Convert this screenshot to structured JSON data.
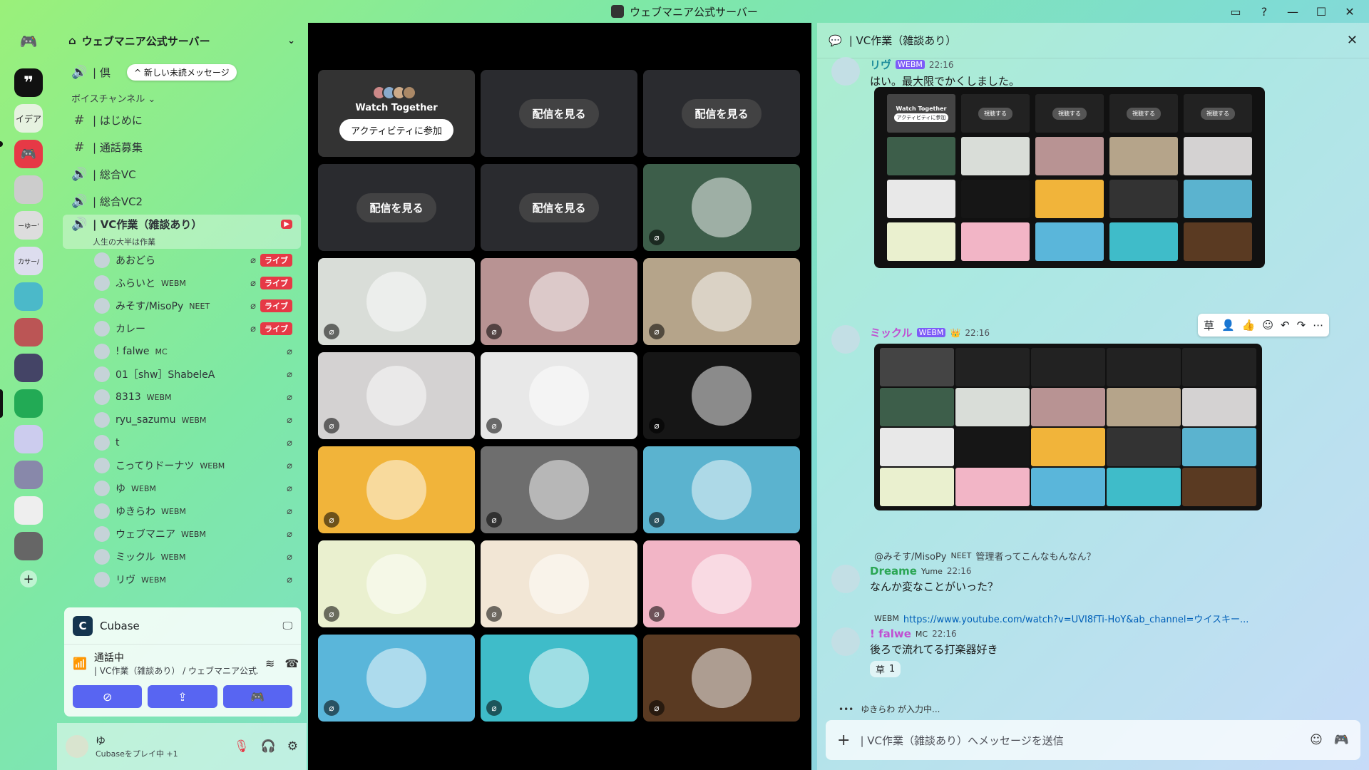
{
  "window": {
    "title": "ウェブマニア公式サーバー"
  },
  "rail": {
    "labels": [
      "イデア",
      "ーゆー'",
      "カサー/"
    ]
  },
  "server": {
    "name": "ウェブマニア公式サーバー",
    "new_messages_badge": "新しい未読メッセージ"
  },
  "channels": {
    "category": "ボイスチャンネル",
    "items": [
      {
        "name": "| はじめに",
        "type": "text"
      },
      {
        "name": "| 通話募集",
        "type": "text"
      },
      {
        "name": "| 総合VC",
        "type": "voice"
      },
      {
        "name": "| 総合VC2",
        "type": "voice"
      },
      {
        "name": "| VC作業（雑談あり）",
        "type": "voice",
        "subtitle": "人生の大半は作業"
      }
    ],
    "partial_first": "| 倶"
  },
  "voice_users": [
    {
      "name": "あおどら",
      "tag": "",
      "live": "ライブ"
    },
    {
      "name": "ふらいと",
      "tag": "WEBM",
      "live": "ライブ"
    },
    {
      "name": "みそす/MisoPy",
      "tag": "NEET",
      "live": "ライブ"
    },
    {
      "name": "カレー",
      "tag": "",
      "live": "ライブ"
    },
    {
      "name": "! falwe",
      "tag": "MC",
      "live": ""
    },
    {
      "name": "01［shw］ShabeleA",
      "tag": "",
      "live": ""
    },
    {
      "name": "8313",
      "tag": "WEBM",
      "live": ""
    },
    {
      "name": "ryu_sazumu",
      "tag": "WEBM",
      "live": ""
    },
    {
      "name": "t",
      "tag": "",
      "live": ""
    },
    {
      "name": "こってりドーナツ",
      "tag": "WEBM",
      "live": ""
    },
    {
      "name": "ゆ",
      "tag": "WEBM",
      "live": ""
    },
    {
      "name": "ゆきらわ",
      "tag": "WEBM",
      "live": ""
    },
    {
      "name": "ウェブマニア",
      "tag": "WEBM",
      "live": ""
    },
    {
      "name": "ミックル",
      "tag": "WEBM",
      "live": ""
    },
    {
      "name": "リヴ",
      "tag": "WEBM",
      "live": ""
    }
  ],
  "panel": {
    "activity": "Cubase",
    "voice_status": "通話中",
    "voice_channel": "| VC作業（雑談あり） / ウェブマニア公式..."
  },
  "user": {
    "name": "ゆ",
    "status": "Cubaseをプレイ中 +1"
  },
  "stage": {
    "watch_together_title": "Watch Together",
    "join_label": "アクティビティに参加",
    "watch_stream_label": "配信を見る",
    "tile_colors": [
      "#333333",
      "#2a2b2f",
      "#2a2b2f",
      "#2a2b2f",
      "#2a2b2f",
      "#3d5e4a",
      "#d9ddd8",
      "#b89393",
      "#b5a48a",
      "#d4d2d2",
      "#e8e8e8",
      "#161616",
      "#f1b43a",
      "#6e6e6e",
      "#5bb3cf",
      "#eaf0cf",
      "#f2e6d5",
      "#f2b5c6",
      "#5ab6da",
      "#3fbcc9",
      "#5a3a22"
    ]
  },
  "thread": {
    "title": "| VC作業（雑談あり）",
    "messages": [
      {
        "name": "リヴ",
        "tag": "WEBM",
        "time": "22:16",
        "text": "はい。最大限でかくしました。"
      },
      {
        "name": "ミックル",
        "tag": "WEBM",
        "time": "22:16",
        "text": ""
      },
      {
        "reply_to": "@みそす/MisoPy",
        "reply_tag": "NEET",
        "reply_text": "管理者ってこんなもんなん？",
        "name": "Dreame",
        "tag": "Yume",
        "time": "22:16",
        "text": "なんか変なことがいった？"
      },
      {
        "reply_tag": "WEBM",
        "reply_text": "https://www.youtube.com/watch?v=UVI8fTi-HoY&ab_channel=ウイスキー...",
        "name": "! falwe",
        "tag": "MC",
        "time": "22:16",
        "text": "後ろで流れてる打楽器好き",
        "reaction_count": "1"
      }
    ],
    "typing": "ゆきらわ が入力中...",
    "composer_placeholder": "| VC作業（雑談あり）へメッセージを送信"
  },
  "mini_shot": {
    "wt_title": "Watch Together",
    "join": "アクティビティに参加",
    "watch": "視聴する",
    "colors": [
      "#444",
      "#222",
      "#222",
      "#222",
      "#222",
      "#3d5e4a",
      "#d9ddd8",
      "#b89393",
      "#b5a48a",
      "#d4d2d2",
      "#e8e8e8",
      "#161616",
      "#f1b43a",
      "#333",
      "#5bb3cf",
      "#eaf0cf",
      "#f2b5c6",
      "#5ab6da",
      "#3fbcc9",
      "#5a3a22"
    ]
  }
}
